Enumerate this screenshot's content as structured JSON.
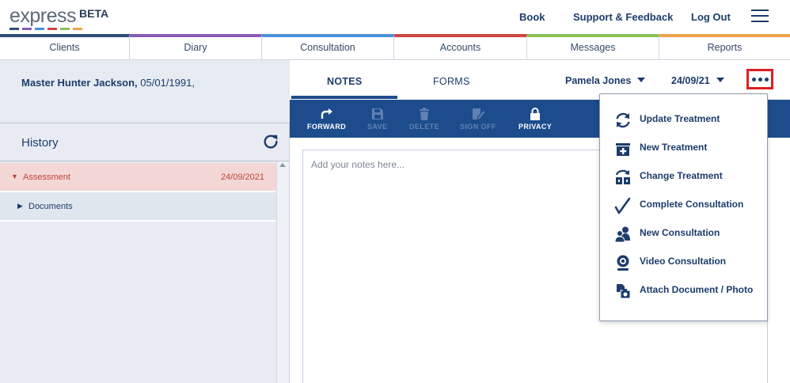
{
  "header": {
    "logo_text": "express",
    "logo_badge": "BETA",
    "logo_bar_colors": [
      "#2e4d7b",
      "#8a5bb8",
      "#4a90d9",
      "#d04545",
      "#8cc152",
      "#f0a04b"
    ],
    "links": {
      "book": "Book",
      "support": "Support & Feedback",
      "logout": "Log Out"
    },
    "menu_icon": "hamburger-icon"
  },
  "nav": {
    "tabs": [
      {
        "label": "Clients",
        "color": "#2e4d7b"
      },
      {
        "label": "Diary",
        "color": "#8a5bb8"
      },
      {
        "label": "Consultation",
        "color": "#4a90d9"
      },
      {
        "label": "Accounts",
        "color": "#d04545"
      },
      {
        "label": "Messages",
        "color": "#8cc152"
      },
      {
        "label": "Reports",
        "color": "#f0a04b"
      }
    ]
  },
  "patient": {
    "name": "Master Hunter Jackson,",
    "dob": " 05/01/1991,"
  },
  "history": {
    "title": "History",
    "refresh_icon": "refresh-icon",
    "items": [
      {
        "label": "Assessment",
        "date": "24/09/2021",
        "expanded": true
      },
      {
        "label": "Documents",
        "date": "",
        "expanded": false
      }
    ]
  },
  "consult": {
    "tabs": {
      "notes": "NOTES",
      "forms": "FORMS"
    },
    "practitioner": "Pamela Jones",
    "date": "24/09/21",
    "more_icon": "ellipsis-icon"
  },
  "toolbar": {
    "forward": "FORWARD",
    "save": "SAVE",
    "delete": "DELETE",
    "sign_off": "SIGN OFF",
    "privacy": "PRIVACY"
  },
  "notes": {
    "placeholder": "Add your notes here...",
    "value": ""
  },
  "menu": {
    "items": [
      {
        "label": "Update Treatment",
        "icon": "sync-icon"
      },
      {
        "label": "New Treatment",
        "icon": "medical-kit-plus-icon"
      },
      {
        "label": "Change Treatment",
        "icon": "change-treatment-icon"
      },
      {
        "label": "Complete Consultation",
        "icon": "checkmark-icon"
      },
      {
        "label": "New Consultation",
        "icon": "people-icon"
      },
      {
        "label": "Video Consultation",
        "icon": "webcam-icon"
      },
      {
        "label": "Attach Document / Photo",
        "icon": "attach-document-icon"
      }
    ]
  },
  "colors": {
    "primary": "#1d3c6b",
    "toolbar_bg": "#1d4c8c",
    "active_history_bg": "#f3d6d6",
    "active_history_text": "#c0433b",
    "highlight_border": "#e01e22"
  }
}
